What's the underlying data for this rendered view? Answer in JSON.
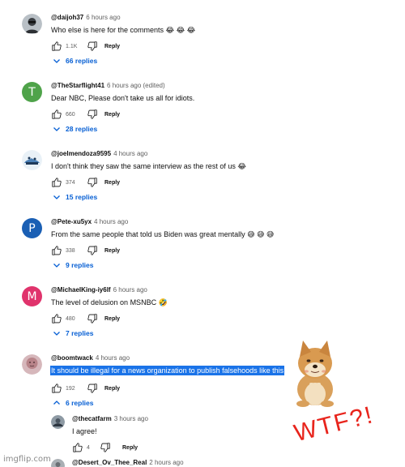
{
  "comments": [
    {
      "author": "@daijoh37",
      "time": "6 hours ago",
      "text": "Who else is here for the comments 😂 😂 😂",
      "likes": "1.1K",
      "reply_label": "Reply",
      "replies_label": "66 replies",
      "avatar_color": "#9aa4ad"
    },
    {
      "author": "@TheStarflight41",
      "time": "6 hours ago (edited)",
      "text": "Dear NBC, Please don't take us all for idiots.",
      "likes": "660",
      "reply_label": "Reply",
      "replies_label": "28 replies",
      "avatar_letter": "T",
      "avatar_color": "#4fa34a"
    },
    {
      "author": "@joelmendoza9595",
      "time": "4 hours ago",
      "text": "I don't think they saw the same interview as the rest of us 😂",
      "likes": "374",
      "reply_label": "Reply",
      "replies_label": "15 replies",
      "avatar_color": "#4a7fb5"
    },
    {
      "author": "@Pete-xu5yx",
      "time": "4 hours ago",
      "text": "From the same people that told us Biden was great mentally 😅 😅 😅",
      "likes": "338",
      "reply_label": "Reply",
      "replies_label": "9 replies",
      "avatar_letter": "P",
      "avatar_color": "#1a5fb4"
    },
    {
      "author": "@MichaelKing-iy6lf",
      "time": "6 hours ago",
      "text": "The level of delusion on MSNBC 🤣",
      "likes": "480",
      "reply_label": "Reply",
      "replies_label": "7 replies",
      "avatar_letter": "M",
      "avatar_color": "#e0336c"
    },
    {
      "author": "@boomtwack",
      "time": "4 hours ago",
      "text": "It should be illegal for a news organization to publish falsehoods like this",
      "likes": "192",
      "reply_label": "Reply",
      "replies_label": "6 replies",
      "avatar_color": "#c99aa0"
    }
  ],
  "replies": [
    {
      "author": "@thecatfarm",
      "time": "3 hours ago",
      "text": "I agree!",
      "likes": "4",
      "reply_label": "Reply",
      "avatar_color": "#4a5560"
    },
    {
      "author": "@Desert_Ov_Thee_Real",
      "time": "2 hours ago",
      "avatar_color": "#6a6f74"
    }
  ],
  "meme_caption": "WTF?!",
  "watermark": "imgflip.com",
  "colors": {
    "link_blue": "#065fd4",
    "highlight": "#1a73e8",
    "caption_red": "#e8241c",
    "muted": "#606060"
  }
}
